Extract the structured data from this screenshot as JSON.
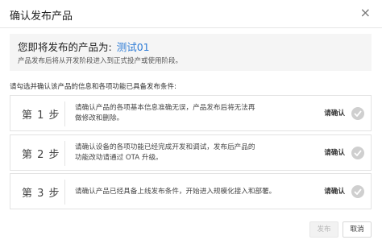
{
  "dialog": {
    "title": "确认发布产品",
    "close_icon": "×"
  },
  "summary": {
    "lead": "您即将发布的产品为:",
    "product_name": "测试01",
    "note": "产品发布后将从开发阶段进入到正式投产或使用阶段。"
  },
  "hint": "请勾选并确认该产品的信息和各项功能已具备发布条件:",
  "steps": [
    {
      "label": "第 1 步",
      "text": "请确认产品的各项基本信息准确无误，产品发布后将无法再做修改和删除。",
      "button": "请确认"
    },
    {
      "label": "第 2 步",
      "text": "请确认设备的各项功能已经完成开发和调试，发布后产品的功能改动请通过 OTA 升级。",
      "button": "请确认"
    },
    {
      "label": "第 3 步",
      "text": "请确认产品已经具备上线发布条件，开始进入规模化接入和部署。",
      "button": "请确认"
    }
  ],
  "footer": {
    "publish_label": "发布",
    "cancel_label": "取消"
  }
}
